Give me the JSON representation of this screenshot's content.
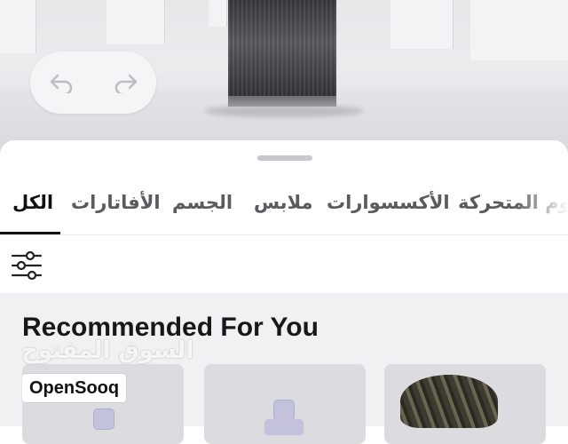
{
  "scene": {
    "undo_icon": "undo-arrow-icon",
    "redo_icon": "redo-arrow-icon"
  },
  "tabs": [
    {
      "label": "الكل",
      "active": true
    },
    {
      "label": "الأفاتارات",
      "active": false
    },
    {
      "label": "الجسم",
      "active": false
    },
    {
      "label": "ملابس",
      "active": false
    },
    {
      "label": "الأكسسوارات",
      "active": false
    },
    {
      "label": "الرسوم المتحركة",
      "active": false
    }
  ],
  "toolbar": {
    "filter_icon": "sliders-filter-icon"
  },
  "main": {
    "section_title": "Recommended For You"
  },
  "watermark": {
    "arabic": "السوق المفتوح",
    "brand": "OpenSooq"
  },
  "colors": {
    "accent": "#111114",
    "tab_inactive": "#5a5a5f",
    "content_bg": "#f1f1f3"
  }
}
